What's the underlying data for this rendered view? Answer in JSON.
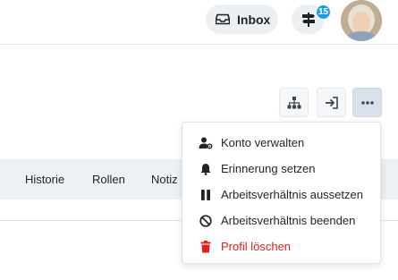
{
  "header": {
    "inbox_label": "Inbox",
    "notifications_count": "15"
  },
  "actions": {
    "org_chart_icon": "sitemap-icon",
    "login_icon": "sign-in-icon",
    "more_icon": "ellipsis-icon"
  },
  "tabs": [
    {
      "label": "Historie"
    },
    {
      "label": "Rollen"
    },
    {
      "label": "Notiz"
    }
  ],
  "menu": {
    "items": [
      {
        "label": "Konto verwalten",
        "icon": "user-cog-icon"
      },
      {
        "label": "Erinnerung setzen",
        "icon": "bell-icon"
      },
      {
        "label": "Arbeitsverhältnis aussetzen",
        "icon": "pause-icon"
      },
      {
        "label": "Arbeitsverhältnis beenden",
        "icon": "ban-icon"
      },
      {
        "label": "Profil löschen",
        "icon": "trash-icon",
        "danger": true
      }
    ]
  },
  "colors": {
    "danger": "#e0201b",
    "badge": "#1aa0e0",
    "tabs_bg": "#eef1f4"
  }
}
